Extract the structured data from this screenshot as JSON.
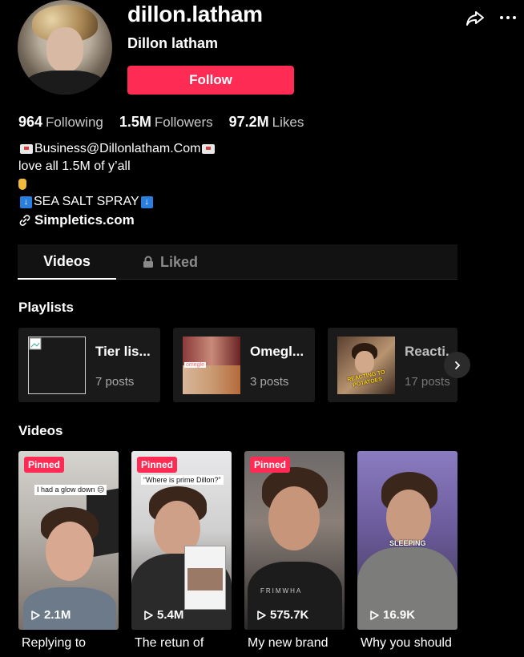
{
  "profile": {
    "username": "dillon.latham",
    "display_name": "Dillon latham",
    "follow_label": "Follow"
  },
  "stats": [
    {
      "value": "964",
      "label": "Following"
    },
    {
      "value": "1.5M",
      "label": "Followers"
    },
    {
      "value": "97.2M",
      "label": "Likes"
    }
  ],
  "bio": {
    "line1": "Business@Dillonlatham.Com",
    "line2": "love all 1.5M of y’all",
    "line4": "SEA SALT SPRAY",
    "link": "Simpletics.com"
  },
  "tabs": {
    "videos": "Videos",
    "liked": "Liked"
  },
  "playlists_title": "Playlists",
  "playlists": [
    {
      "title": "Tier lis...",
      "count": "7 posts"
    },
    {
      "title": "Omegl...",
      "count": "3 posts"
    },
    {
      "title": "Reacti...",
      "count": "17 posts"
    }
  ],
  "playlist_thumb_text": {
    "omegle_tag": "omegle",
    "react_tag": "REACTING TO POTATOES"
  },
  "videos_title": "Videos",
  "videos": [
    {
      "pinned": "Pinned",
      "views": "2.1M",
      "title": "Replying to",
      "overlay": "I had a glow down 😔"
    },
    {
      "pinned": "Pinned",
      "views": "5.4M",
      "title": "The retun of",
      "overlay": "“Where is prime Dillon?”"
    },
    {
      "pinned": "Pinned",
      "views": "575.7K",
      "title": "My new brand",
      "overlay": ""
    },
    {
      "pinned": "",
      "views": "16.9K",
      "title": "Why you should",
      "overlay": "SLEEPING"
    }
  ],
  "colors": {
    "accent": "#fe2c55",
    "bg": "#000000",
    "card": "#1a1a1a"
  }
}
